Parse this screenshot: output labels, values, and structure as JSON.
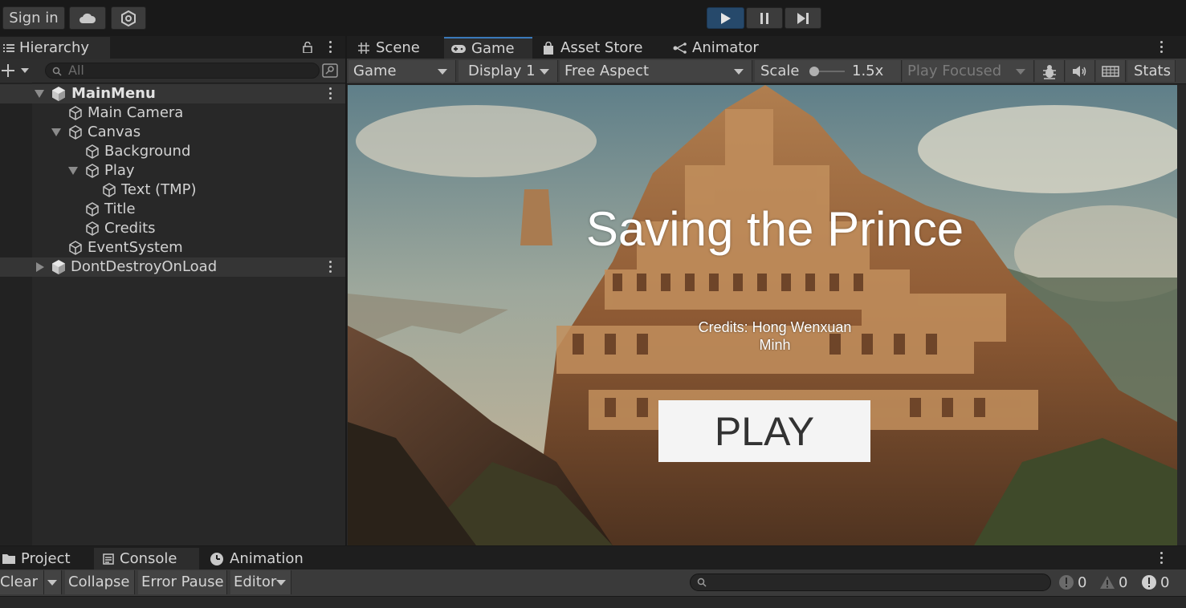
{
  "toolbar": {
    "signin_label": "Sign in",
    "cloud_icon": "cloud-icon",
    "collab_icon": "collab-icon",
    "play_icon": "play-icon",
    "pause_icon": "pause-icon",
    "step_icon": "step-icon",
    "play_active_color": "#26496b"
  },
  "hierarchy": {
    "tab_label": "Hierarchy",
    "search_placeholder": "All",
    "items": [
      {
        "label": "MainMenu",
        "type": "scene",
        "expanded": true
      },
      {
        "label": "Main Camera",
        "type": "object"
      },
      {
        "label": "Canvas",
        "type": "object",
        "expanded": true
      },
      {
        "label": "Background",
        "type": "object"
      },
      {
        "label": "Play",
        "type": "object",
        "expanded": true
      },
      {
        "label": "Text (TMP)",
        "type": "object"
      },
      {
        "label": "Title",
        "type": "object"
      },
      {
        "label": "Credits",
        "type": "object"
      },
      {
        "label": "EventSystem",
        "type": "object"
      },
      {
        "label": "DontDestroyOnLoad",
        "type": "scene",
        "expanded": false
      }
    ]
  },
  "editor_tabs": {
    "scene": "Scene",
    "game": "Game",
    "asset_store": "Asset Store",
    "animator": "Animator"
  },
  "game_toolbar": {
    "mode": "Game",
    "display": "Display 1",
    "aspect": "Free Aspect",
    "scale_label": "Scale",
    "scale_value": "1.5x",
    "play_focus": "Play Focused",
    "stats": "Stats"
  },
  "game_view": {
    "title": "Saving the Prince",
    "credits_line1": "Credits: Hong Wenxuan",
    "credits_line2": "Minh",
    "play_button": "PLAY"
  },
  "bottom": {
    "tabs": {
      "project": "Project",
      "console": "Console",
      "animation": "Animation"
    },
    "clear": "Clear",
    "collapse": "Collapse",
    "error_pause": "Error Pause",
    "editor": "Editor",
    "info_count": "0",
    "warn_count": "0",
    "error_count": "0"
  }
}
